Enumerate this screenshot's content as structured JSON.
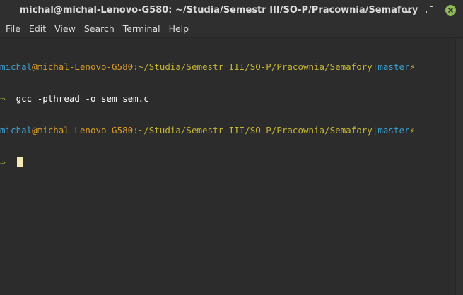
{
  "window": {
    "title": "michal@michal-Lenovo-G580: ~/Studia/Semestr III/SO-P/Pracownia/Semafory"
  },
  "titlebar_buttons": {
    "minimize_icon": "minimize-icon",
    "maximize_icon": "maximize-icon",
    "close_icon": "close-icon"
  },
  "menu": {
    "items": [
      "File",
      "Edit",
      "View",
      "Search",
      "Terminal",
      "Help"
    ]
  },
  "terminal": {
    "prompt": {
      "user": "michal",
      "at": "@",
      "host": "michal-Lenovo-G580",
      "colon": ":",
      "path": "~/Studia/Semestr III/SO-P/Pracownia/Semafory",
      "separator": "|",
      "branch": "master",
      "bolt": "⚡",
      "arrow": "⇒"
    },
    "lines": [
      {
        "command": "gcc -pthread -o sem sem.c"
      },
      {
        "command": ""
      }
    ]
  },
  "colors": {
    "background": "#2c2c2c",
    "user": "#3aa0d0",
    "host": "#d79a2a",
    "path": "#c4b535",
    "separator": "#e04444",
    "arrow": "#b0c23a",
    "cursor": "#f3e9b5",
    "close_button": "#8fba5a"
  }
}
